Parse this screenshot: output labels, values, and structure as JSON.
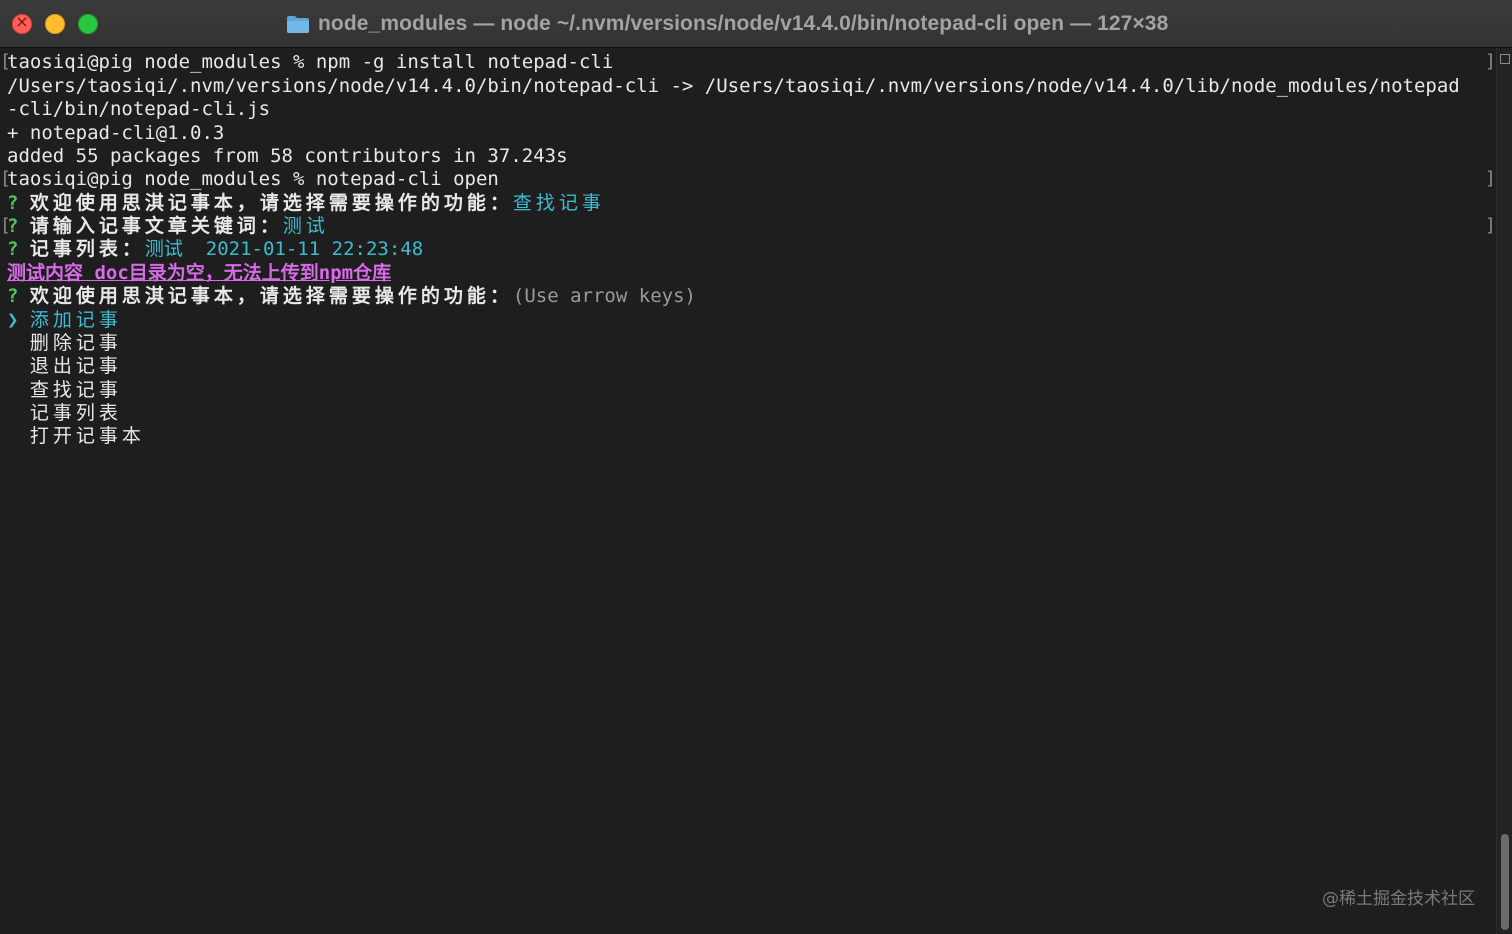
{
  "window": {
    "title": "node_modules — node ~/.nvm/versions/node/v14.4.0/bin/notepad-cli open — 127×38",
    "folder_icon": "folder-icon"
  },
  "terminal": {
    "lines": [
      {
        "id": "l1",
        "text": "taosiqi@pig node_modules % npm -g install notepad-cli"
      },
      {
        "id": "l2",
        "text": "/Users/taosiqi/.nvm/versions/node/v14.4.0/bin/notepad-cli -> /Users/taosiqi/.nvm/versions/node/v14.4.0/lib/node_modules/notepad"
      },
      {
        "id": "l3",
        "text": "-cli/bin/notepad-cli.js"
      },
      {
        "id": "l4",
        "text": "+ notepad-cli@1.0.3"
      },
      {
        "id": "l5",
        "text": "added 55 packages from 58 contributors in 37.243s"
      },
      {
        "id": "l6",
        "text": "taosiqi@pig node_modules % notepad-cli open"
      }
    ],
    "prompt_mark": "?",
    "q1": {
      "label": "欢迎使用思淇记事本，请选择需要操作的功能：",
      "answer": "查找记事"
    },
    "q2": {
      "label": "请输入记事文章关键词：",
      "answer": "测试"
    },
    "q3": {
      "label": "记事列表：",
      "answer": "测试  2021-01-11 22:23:48"
    },
    "error": "测试内容 doc目录为空，无法上传到npm仓库",
    "q4": {
      "label": "欢迎使用思淇记事本，请选择需要操作的功能：",
      "hint": "(Use arrow keys)"
    },
    "menu": {
      "pointer": "❯",
      "selected": "添加记事",
      "options": [
        "删除记事",
        "退出记事",
        "查找记事",
        "记事列表",
        "打开记事本"
      ]
    }
  },
  "watermark": "@稀土掘金技术社区",
  "colors": {
    "background": "#1e1e1e",
    "prompt_green": "#4fc35a",
    "answer_cyan": "#3dbbd3",
    "error_magenta": "#d66be6"
  }
}
